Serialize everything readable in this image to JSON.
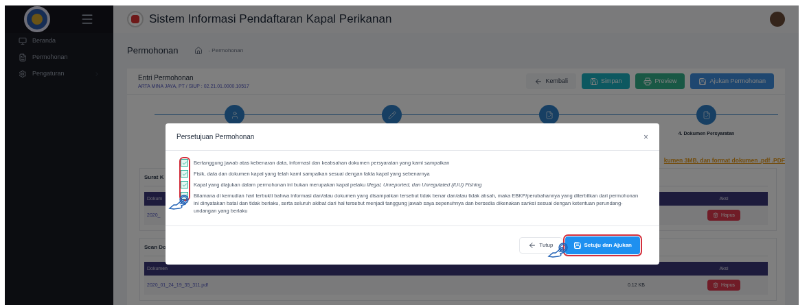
{
  "app_title": "Sistem Informasi Pendaftaran Kapal Perikanan",
  "sidebar": {
    "items": [
      {
        "label": "Beranda",
        "expandable": false
      },
      {
        "label": "Permohonan",
        "expandable": false
      },
      {
        "label": "Pengaturan",
        "expandable": true
      }
    ]
  },
  "page_header": {
    "title": "Permohonan",
    "breadcrumb": "- Permohonan"
  },
  "entry": {
    "title": "Entri Permohonan",
    "subtitle": "ARTA MINA JAYA, PT / SIUP : 02.21.01.0000.10517",
    "buttons": [
      {
        "label": "Kembali",
        "kind": "back"
      },
      {
        "label": "Simpan",
        "kind": "save"
      },
      {
        "label": "Preview",
        "kind": "print"
      },
      {
        "label": "Ajukan Permohonan",
        "kind": "submit"
      }
    ]
  },
  "steps": [
    {
      "kind": "person"
    },
    {
      "kind": "edit"
    },
    {
      "kind": "document"
    },
    {
      "kind": "document",
      "label": "4. Dokumen Persyaratan"
    }
  ],
  "note": "kumen 3MB, dan format dokumen .pdf .PDF",
  "sections": [
    {
      "title": "Surat K",
      "header": [
        "Dokum",
        "Aksi"
      ],
      "rows": [
        {
          "file": "2020_",
          "size": "",
          "action": "Hapus"
        }
      ]
    },
    {
      "title": "Scan Do",
      "header": [
        "Dokumen",
        "Aksi"
      ],
      "rows": [
        {
          "file": "2020_01_24_19_35_311.pdf",
          "size": "0.12 KB",
          "action": "Hapus"
        }
      ]
    }
  ],
  "modal": {
    "title": "Persetujuan Permohonan",
    "close": "×",
    "items": [
      {
        "text": "Bertanggung jawab atas kebenaran data, informasi dan keabsahan dokumen persyaratan yang kami sampaikan",
        "checked": true
      },
      {
        "text": "Fisik, data dan dokumen kapal yang telah kami sampaikan sesuai dengan fakta kapal yang sebenarnya",
        "checked": true
      },
      {
        "text": "Kapal yang diajukan dalam permohonan ini bukan merupakan kapal pelaku *Illegal, Unreported, dan Unregulated (IUU) Fishing*",
        "checked": true
      },
      {
        "text": "Bilamana di kemudian hari terbukti bahwa informasi dan/atau dokumen yang disampaikan tersebut tidak benar dan/atau tidak absah, maka EBKP/perubahannya yang diterbitkan dari permohonan ini dinyatakan batal dan tidak berlaku, serta seluruh akibat dari hal tersebut menjadi tanggung jawab saya sepenuhnya dan bersedia dikenakan sanksi sesuai dengan ketentuan perundang-undangan yang berlaku",
        "checked": true
      }
    ],
    "cancel": "Tutup",
    "confirm": "Setuju dan Ajukan"
  }
}
